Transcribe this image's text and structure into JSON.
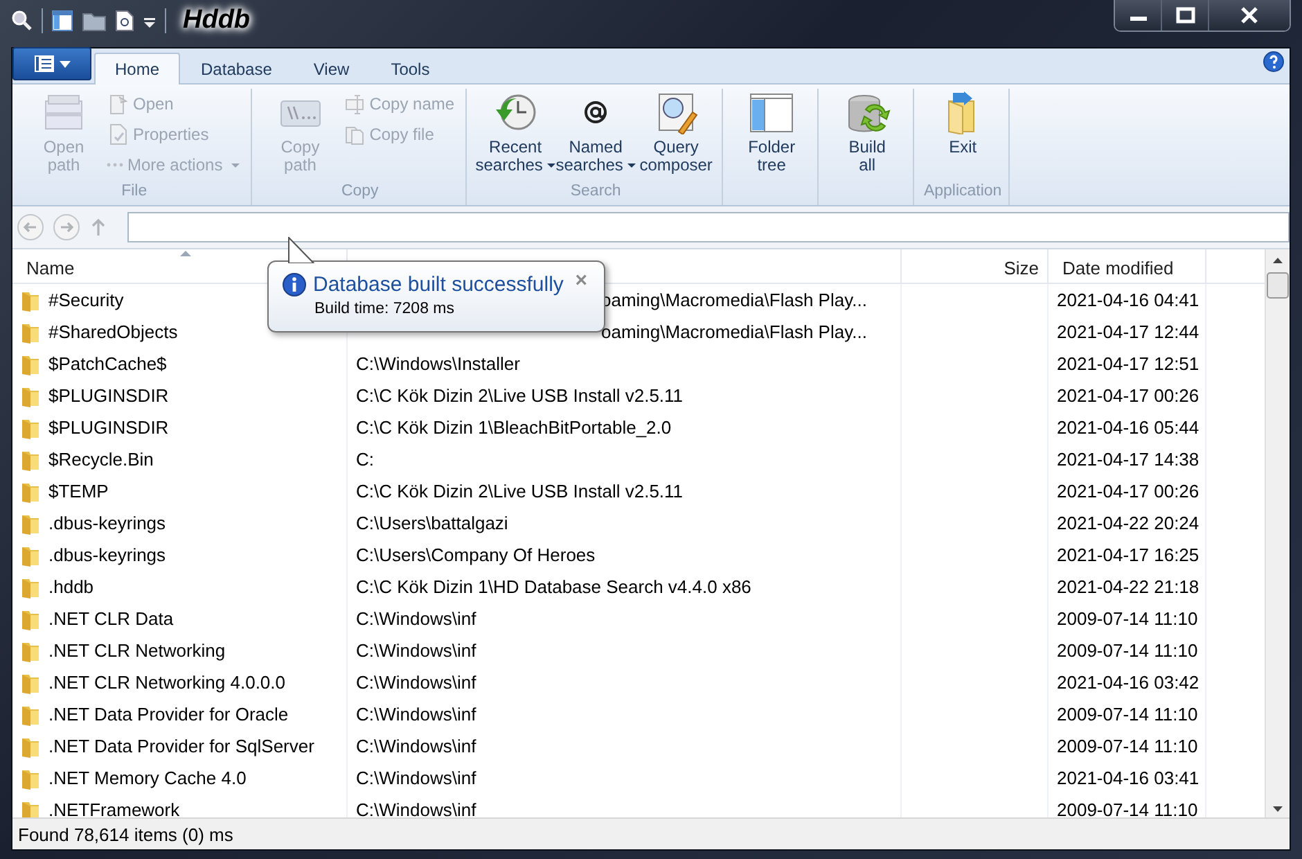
{
  "window": {
    "title": "Hddb"
  },
  "ribbon": {
    "tabs": [
      {
        "label": "Home",
        "selected": true
      },
      {
        "label": "Database",
        "selected": false
      },
      {
        "label": "View",
        "selected": false
      },
      {
        "label": "Tools",
        "selected": false
      }
    ],
    "groups": [
      {
        "label": "File",
        "large": [
          {
            "label": "Open path",
            "disabled": true,
            "dropdown": false
          }
        ],
        "small": [
          {
            "label": "Open",
            "disabled": true,
            "dropdown": false
          },
          {
            "label": "Properties",
            "disabled": true,
            "dropdown": false
          },
          {
            "label": "More actions",
            "disabled": true,
            "dropdown": true
          }
        ]
      },
      {
        "label": "Copy",
        "large": [
          {
            "label": "Copy path",
            "disabled": true,
            "dropdown": false
          }
        ],
        "small": [
          {
            "label": "Copy name",
            "disabled": true,
            "dropdown": false
          },
          {
            "label": "Copy file",
            "disabled": true,
            "dropdown": false
          }
        ]
      },
      {
        "label": "Search",
        "large": [
          {
            "label": "Recent searches",
            "disabled": false,
            "dropdown": true
          },
          {
            "label": "Named searches",
            "disabled": false,
            "dropdown": true
          },
          {
            "label": "Query composer",
            "disabled": false,
            "dropdown": false
          }
        ]
      },
      {
        "large": [
          {
            "label": "Folder tree",
            "disabled": false,
            "dropdown": false
          }
        ]
      },
      {
        "large": [
          {
            "label": "Build all",
            "disabled": false,
            "dropdown": false
          }
        ]
      },
      {
        "label": "Application",
        "large": [
          {
            "label": "Exit",
            "disabled": false,
            "dropdown": false
          }
        ]
      }
    ]
  },
  "table": {
    "columns": [
      {
        "label": "Name",
        "sorted": true
      },
      {},
      {
        "label": "Size"
      },
      {
        "label": "Date modified"
      }
    ],
    "rows": [
      {
        "name": "#Security",
        "path": "oaming\\Macromedia\\Flash Play...",
        "partial": true,
        "date": "2021-04-16 04:41"
      },
      {
        "name": "#SharedObjects",
        "path": "oaming\\Macromedia\\Flash Play...",
        "partial": true,
        "date": "2021-04-17 12:44"
      },
      {
        "name": "$PatchCache$",
        "path": "C:\\Windows\\Installer",
        "date": "2021-04-17 12:51"
      },
      {
        "name": "$PLUGINSDIR",
        "path": "C:\\C Kök Dizin 2\\Live USB Install v2.5.11",
        "date": "2021-04-17 00:26"
      },
      {
        "name": "$PLUGINSDIR",
        "path": "C:\\C Kök Dizin 1\\BleachBitPortable_2.0",
        "date": "2021-04-16 05:44"
      },
      {
        "name": "$Recycle.Bin",
        "path": "C:",
        "date": "2021-04-17 14:38"
      },
      {
        "name": "$TEMP",
        "path": "C:\\C Kök Dizin 2\\Live USB Install v2.5.11",
        "date": "2021-04-17 00:26"
      },
      {
        "name": ".dbus-keyrings",
        "path": "C:\\Users\\battalgazi",
        "date": "2021-04-22 20:24"
      },
      {
        "name": ".dbus-keyrings",
        "path": "C:\\Users\\Company Of Heroes",
        "date": "2021-04-17 16:25"
      },
      {
        "name": ".hddb",
        "path": "C:\\C Kök Dizin 1\\HD Database Search v4.4.0 x86",
        "date": "2021-04-22 21:18"
      },
      {
        "name": ".NET CLR Data",
        "path": "C:\\Windows\\inf",
        "date": "2009-07-14 11:10"
      },
      {
        "name": ".NET CLR Networking",
        "path": "C:\\Windows\\inf",
        "date": "2009-07-14 11:10"
      },
      {
        "name": ".NET CLR Networking 4.0.0.0",
        "path": "C:\\Windows\\inf",
        "date": "2021-04-16 03:42"
      },
      {
        "name": ".NET Data Provider for Oracle",
        "path": "C:\\Windows\\inf",
        "date": "2009-07-14 11:10"
      },
      {
        "name": ".NET Data Provider for SqlServer",
        "path": "C:\\Windows\\inf",
        "date": "2009-07-14 11:10"
      },
      {
        "name": ".NET Memory Cache 4.0",
        "path": "C:\\Windows\\inf",
        "date": "2021-04-16 03:41"
      },
      {
        "name": ".NETFramework",
        "path": "C:\\Windows\\inf",
        "date": "2009-07-14 11:10"
      }
    ]
  },
  "notification": {
    "title": "Database built successfully",
    "message": "Build time: 7208 ms",
    "close": "×"
  },
  "status_bar": {
    "text": "Found 78,614 items (0) ms"
  }
}
